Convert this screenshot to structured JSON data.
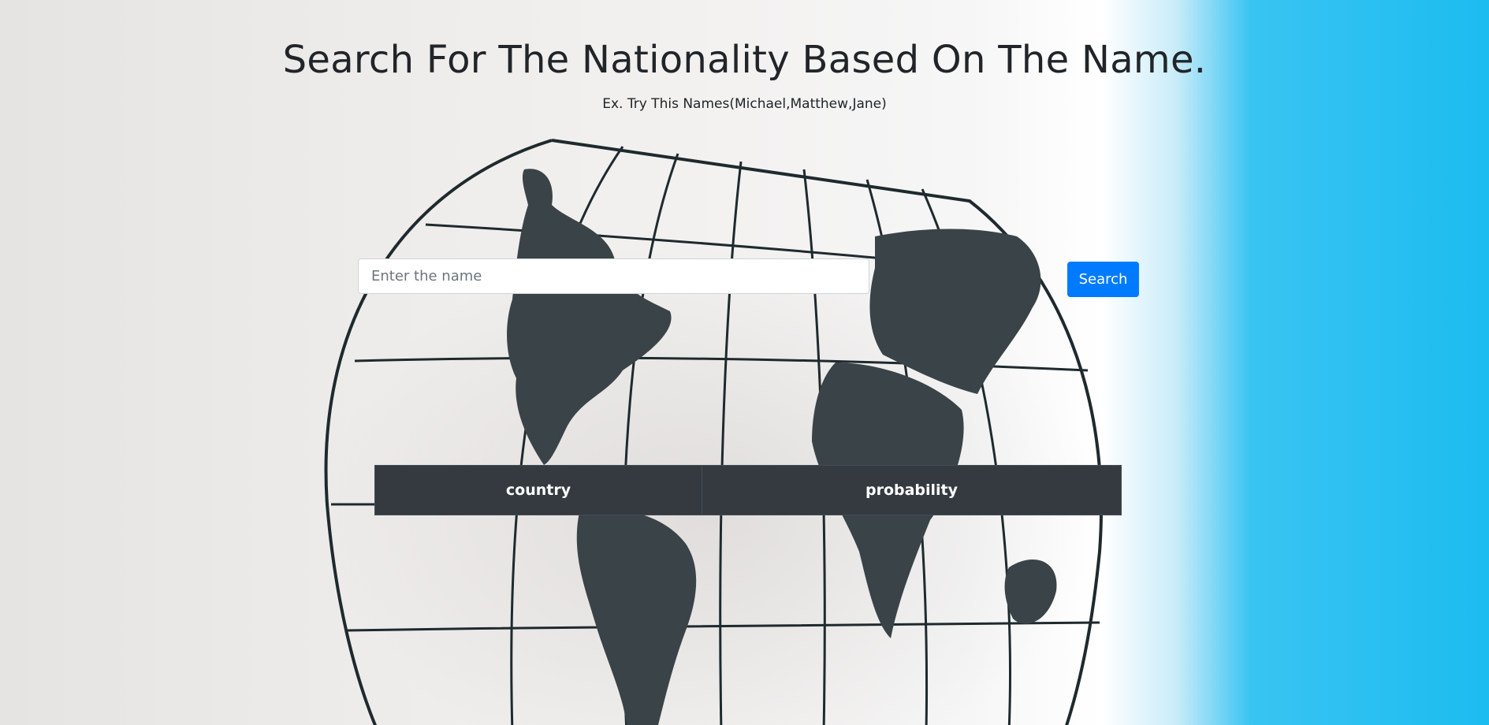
{
  "header": {
    "title": "Search For The Nationality Based On The Name.",
    "hint": "Ex. Try This Names(Michael,Matthew,Jane)"
  },
  "search": {
    "placeholder": "Enter the name",
    "value": "",
    "button_label": "Search"
  },
  "results_table": {
    "columns": [
      "country",
      "probability"
    ],
    "rows": []
  },
  "colors": {
    "primary": "#007bff",
    "table_header": "#343a40",
    "text": "#212529",
    "background_accent": "#1cbcf0"
  }
}
